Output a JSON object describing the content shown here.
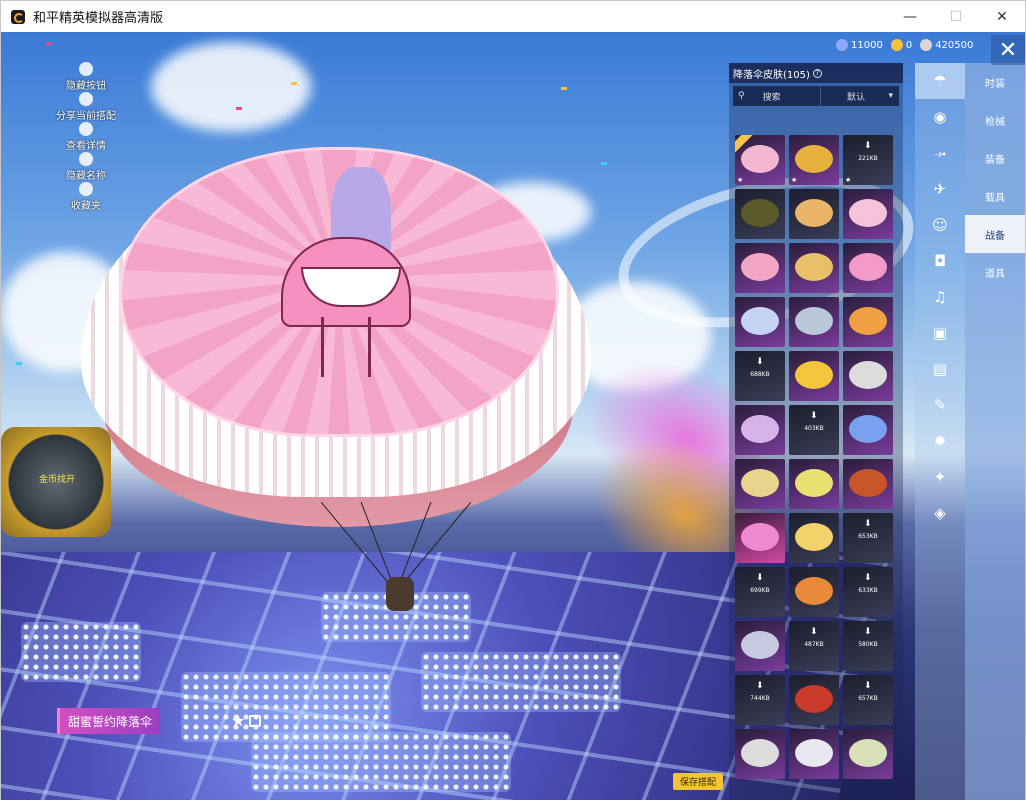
{
  "window": {
    "title": "和平精英模拟器高清版",
    "controls": {
      "minimize": "—",
      "maximize": "☐",
      "close": "✕"
    }
  },
  "hud": {
    "left_menu": [
      {
        "label": "隐藏按钮"
      },
      {
        "label": "分享当前搭配"
      },
      {
        "label": "查看详情"
      },
      {
        "label": "隐藏名称"
      },
      {
        "label": "收藏夹"
      }
    ],
    "currency": [
      {
        "icon": "coin-icon",
        "value": "11000",
        "color": "#8fa8ff"
      },
      {
        "icon": "gem-icon",
        "value": "0",
        "color": "#f2c43a"
      },
      {
        "icon": "shield-coin-icon",
        "value": "420500",
        "color": "#d7d7d7"
      }
    ],
    "close_label": "✕"
  },
  "panel": {
    "title": "降落伞皮肤(105)",
    "help": "?",
    "search_label": "搜索",
    "sort_label": "默认",
    "items": [
      {
        "style": "purple",
        "color": "#f3b6cf",
        "badge": true,
        "star": true,
        "size": ""
      },
      {
        "style": "purple",
        "color": "#e7b23c",
        "badge": false,
        "star": true,
        "size": ""
      },
      {
        "style": "dark",
        "color": "",
        "badge": false,
        "star": true,
        "size": "221KB"
      },
      {
        "style": "dark",
        "color": "#5a5a2a",
        "badge": false,
        "star": false,
        "size": ""
      },
      {
        "style": "dark",
        "color": "#e8b56b",
        "badge": false,
        "star": false,
        "size": ""
      },
      {
        "style": "purple",
        "color": "#f6c4d8",
        "badge": false,
        "star": false,
        "size": ""
      },
      {
        "style": "purple",
        "color": "#f2a6c3",
        "badge": false,
        "star": false,
        "size": ""
      },
      {
        "style": "purple",
        "color": "#e8c06a",
        "badge": false,
        "star": false,
        "size": ""
      },
      {
        "style": "purple",
        "color": "#f49ac8",
        "badge": false,
        "star": false,
        "size": ""
      },
      {
        "style": "purple",
        "color": "#c5d4f5",
        "badge": false,
        "star": false,
        "size": ""
      },
      {
        "style": "purple",
        "color": "#b8c8d8",
        "badge": false,
        "star": false,
        "size": ""
      },
      {
        "style": "purple",
        "color": "#f0a040",
        "badge": false,
        "star": false,
        "size": ""
      },
      {
        "style": "dark",
        "color": "",
        "badge": false,
        "star": false,
        "size": "688KB"
      },
      {
        "style": "purple",
        "color": "#f3c53a",
        "badge": false,
        "star": false,
        "size": ""
      },
      {
        "style": "purple",
        "color": "#dcdcdc",
        "badge": false,
        "star": false,
        "size": ""
      },
      {
        "style": "purple",
        "color": "#d7b4e8",
        "badge": false,
        "star": false,
        "size": ""
      },
      {
        "style": "dark",
        "color": "",
        "badge": false,
        "star": false,
        "size": "403KB"
      },
      {
        "style": "purple",
        "color": "#7aa0f0",
        "badge": false,
        "star": false,
        "size": ""
      },
      {
        "style": "purple",
        "color": "#e8d48a",
        "badge": false,
        "star": false,
        "size": ""
      },
      {
        "style": "purple",
        "color": "#e8e070",
        "badge": false,
        "star": false,
        "size": ""
      },
      {
        "style": "purple",
        "color": "#c8552a",
        "badge": false,
        "star": false,
        "size": ""
      },
      {
        "style": "pink",
        "color": "#f08ad0",
        "badge": false,
        "star": false,
        "size": ""
      },
      {
        "style": "dark",
        "color": "#f2d26a",
        "badge": false,
        "star": false,
        "size": ""
      },
      {
        "style": "dark",
        "color": "",
        "badge": false,
        "star": false,
        "size": "653KB"
      },
      {
        "style": "dark",
        "color": "",
        "badge": false,
        "star": false,
        "size": "699KB"
      },
      {
        "style": "dark",
        "color": "#e88a3a",
        "badge": false,
        "star": false,
        "size": ""
      },
      {
        "style": "dark",
        "color": "",
        "badge": false,
        "star": false,
        "size": "633KB"
      },
      {
        "style": "purple",
        "color": "#c8c8e0",
        "badge": false,
        "star": false,
        "size": ""
      },
      {
        "style": "dark",
        "color": "",
        "badge": false,
        "star": false,
        "size": "487KB"
      },
      {
        "style": "dark",
        "color": "",
        "badge": false,
        "star": false,
        "size": "580KB"
      },
      {
        "style": "dark",
        "color": "",
        "badge": false,
        "star": false,
        "size": "744KB"
      },
      {
        "style": "dark",
        "color": "#c83a2a",
        "badge": false,
        "star": false,
        "size": ""
      },
      {
        "style": "dark",
        "color": "",
        "badge": false,
        "star": false,
        "size": "657KB"
      },
      {
        "style": "purple",
        "color": "#dcdcdc",
        "badge": false,
        "star": false,
        "size": ""
      },
      {
        "style": "purple",
        "color": "#e8e8f0",
        "badge": false,
        "star": false,
        "size": ""
      },
      {
        "style": "purple",
        "color": "#d8e0b8",
        "badge": false,
        "star": false,
        "size": ""
      }
    ]
  },
  "side_icons": [
    {
      "icon": "parachute-icon",
      "glyph": "☂",
      "active": true
    },
    {
      "icon": "eye-icon",
      "glyph": "◉",
      "active": false
    },
    {
      "icon": "glider-icon",
      "glyph": "⤞",
      "active": false
    },
    {
      "icon": "plane-icon",
      "glyph": "✈",
      "active": false
    },
    {
      "icon": "emote-icon",
      "glyph": "☺",
      "active": false
    },
    {
      "icon": "robot-icon",
      "glyph": "◘",
      "active": false
    },
    {
      "icon": "sound-icon",
      "glyph": "♫",
      "active": false
    },
    {
      "icon": "frame-icon",
      "glyph": "▣",
      "active": false
    },
    {
      "icon": "picture-icon",
      "glyph": "▤",
      "active": false
    },
    {
      "icon": "spray-icon",
      "glyph": "✎",
      "active": false
    },
    {
      "icon": "grenade-icon",
      "glyph": "✹",
      "active": false
    },
    {
      "icon": "wand-icon",
      "glyph": "✦",
      "active": false
    },
    {
      "icon": "vehicle-icon",
      "glyph": "◈",
      "active": false
    }
  ],
  "tabs": [
    {
      "label": "时装",
      "active": false
    },
    {
      "label": "枪械",
      "active": false
    },
    {
      "label": "装备",
      "active": false
    },
    {
      "label": "载具",
      "active": false
    },
    {
      "label": "战备",
      "active": true
    },
    {
      "label": "道具",
      "active": false
    }
  ],
  "preview": {
    "item_name": "甜蜜誓约降落伞",
    "fav_glyph": "★",
    "save_label": "保存搭配",
    "booth_label": "金币找开"
  }
}
